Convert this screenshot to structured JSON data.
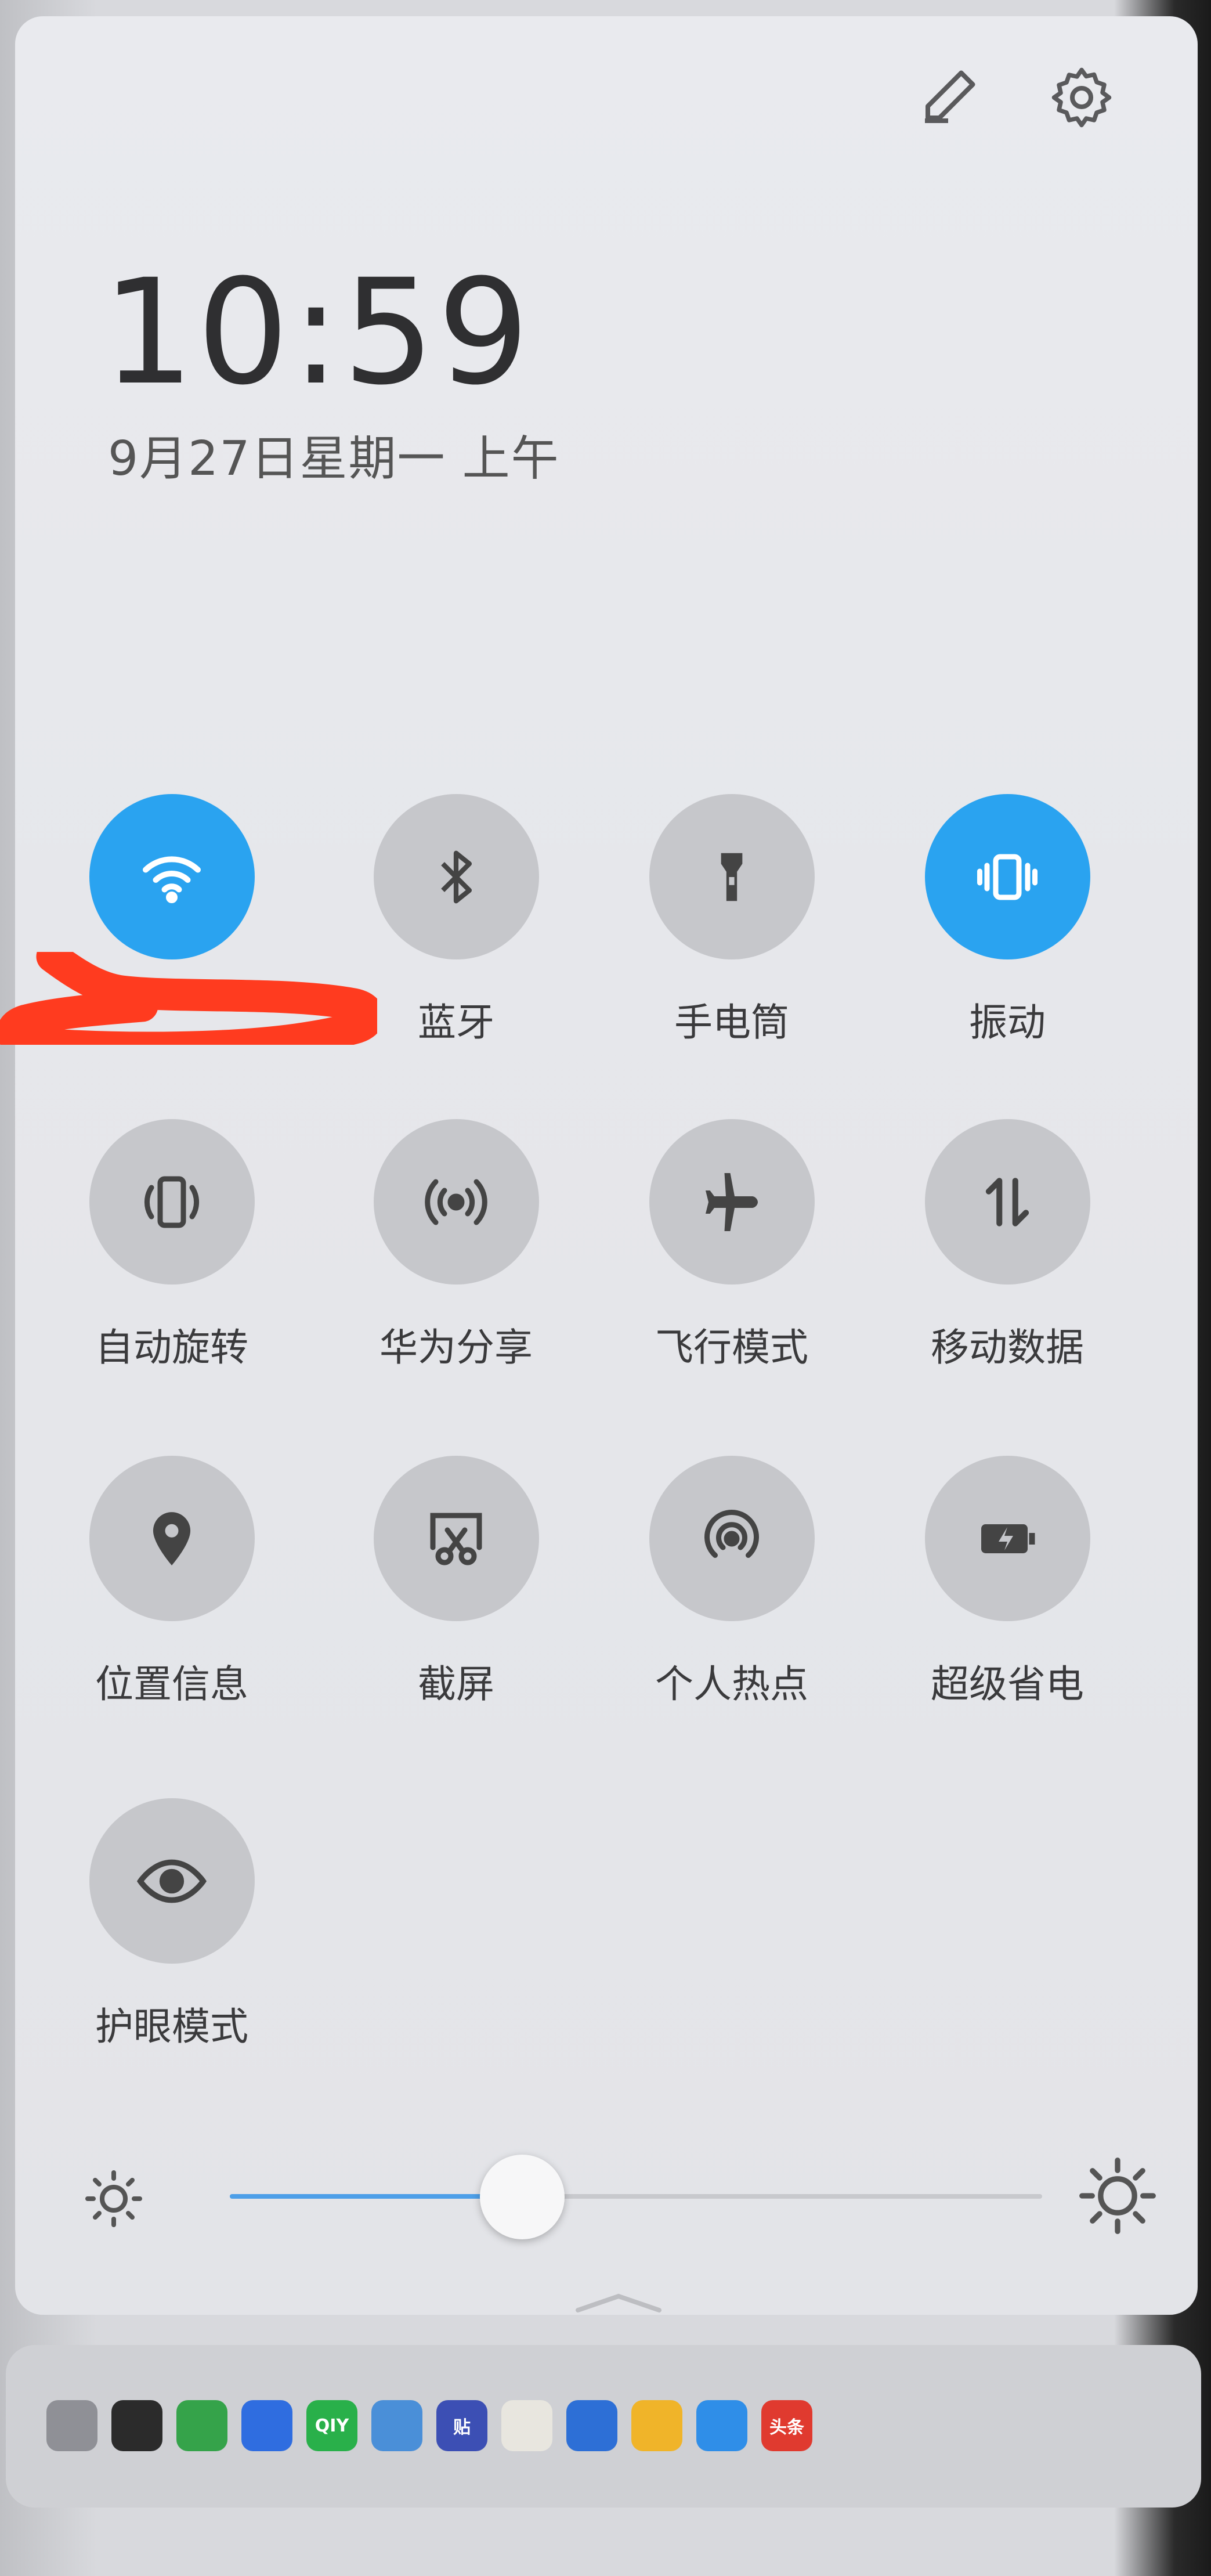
{
  "clock": {
    "time": "10:59",
    "date": "9月27日星期一 上午"
  },
  "top_icons": [
    "edit-icon",
    "settings-icon"
  ],
  "tiles": [
    {
      "label": "",
      "icon": "wifi-icon",
      "active": true
    },
    {
      "label": "蓝牙",
      "icon": "bluetooth-icon",
      "active": false
    },
    {
      "label": "手电筒",
      "icon": "flashlight-icon",
      "active": false
    },
    {
      "label": "振动",
      "icon": "vibrate-icon",
      "active": true
    },
    {
      "label": "自动旋转",
      "icon": "auto-rotate-icon",
      "active": false
    },
    {
      "label": "华为分享",
      "icon": "huawei-share-icon",
      "active": false
    },
    {
      "label": "飞行模式",
      "icon": "airplane-icon",
      "active": false
    },
    {
      "label": "移动数据",
      "icon": "mobile-data-icon",
      "active": false
    },
    {
      "label": "位置信息",
      "icon": "location-icon",
      "active": false
    },
    {
      "label": "截屏",
      "icon": "screenshot-icon",
      "active": false
    },
    {
      "label": "个人热点",
      "icon": "hotspot-icon",
      "active": false
    },
    {
      "label": "超级省电",
      "icon": "battery-saver-icon",
      "active": false
    },
    {
      "label": "护眼模式",
      "icon": "eye-comfort-icon",
      "active": false
    }
  ],
  "brightness": {
    "level": 0.36
  },
  "notification_apps": [
    {
      "name": "files-icon",
      "color": "#8f9096",
      "text": ""
    },
    {
      "name": "qq-icon",
      "color": "#2b2b2b",
      "text": ""
    },
    {
      "name": "app-green-icon",
      "color": "#35a34a",
      "text": ""
    },
    {
      "name": "baidu-icon",
      "color": "#2f6de0",
      "text": ""
    },
    {
      "name": "iqiyi-icon",
      "color": "#29b04a",
      "text": "QIY"
    },
    {
      "name": "app-blue-icon",
      "color": "#4a8fd8",
      "text": ""
    },
    {
      "name": "tieba-icon",
      "color": "#3c4fb4",
      "text": "贴"
    },
    {
      "name": "app-reading-icon",
      "color": "#e8e6df",
      "text": ""
    },
    {
      "name": "bulb-icon",
      "color": "#2d6fd6",
      "text": ""
    },
    {
      "name": "weibo-icon",
      "color": "#f0b429",
      "text": ""
    },
    {
      "name": "app-yellow-icon",
      "color": "#2f8ee8",
      "text": ""
    },
    {
      "name": "toutiao-icon",
      "color": "#e03a2f",
      "text": "头条"
    }
  ],
  "colors": {
    "active": "#2aa3f0",
    "inactive": "#c6c7cb",
    "redaction": "#ff3b1f"
  }
}
